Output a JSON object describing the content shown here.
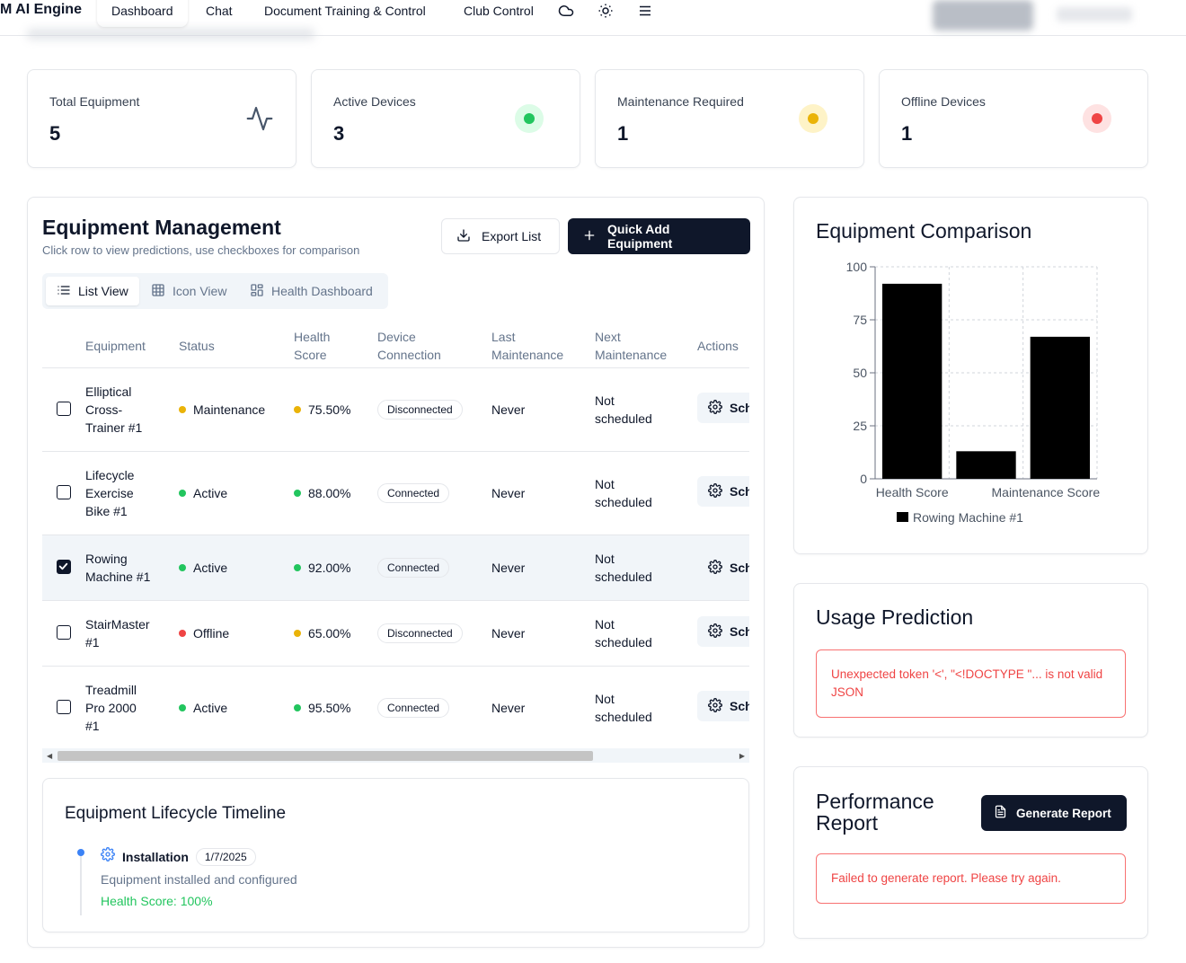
{
  "nav": {
    "brand": "M AI Engine",
    "tabs": [
      "Dashboard",
      "Chat",
      "Document Training & Control",
      "Club Control"
    ],
    "active_tab": "Dashboard"
  },
  "stats": [
    {
      "label": "Total Equipment",
      "value": "5",
      "icon": "activity-icon"
    },
    {
      "label": "Active Devices",
      "value": "3",
      "color": "#22c55e"
    },
    {
      "label": "Maintenance Required",
      "value": "1",
      "color": "#eab308"
    },
    {
      "label": "Offline Devices",
      "value": "1",
      "color": "#ef4444"
    }
  ],
  "equipment": {
    "title": "Equipment Management",
    "subtitle": "Click row to view predictions, use checkboxes for comparison",
    "export_label": "Export List",
    "quick_add_label": "Quick Add Equipment",
    "views": [
      "List View",
      "Icon View",
      "Health Dashboard"
    ],
    "active_view": "List View",
    "columns": {
      "equipment": "Equipment",
      "status": "Status",
      "health": [
        "Health",
        "Score"
      ],
      "device": [
        "Device",
        "Connection"
      ],
      "last": [
        "Last",
        "Maintenance"
      ],
      "next": [
        "Next",
        "Maintenance"
      ],
      "actions": "Actions"
    },
    "action_label": "Sch",
    "rows": [
      {
        "name": [
          "Elliptical",
          "Cross-",
          "Trainer #1"
        ],
        "status": "Maintenance",
        "status_color": "#eab308",
        "health": "75.50%",
        "health_color": "#eab308",
        "connection": "Disconnected",
        "last": "Never",
        "next": [
          "Not",
          "scheduled"
        ],
        "checked": false
      },
      {
        "name": [
          "Lifecycle",
          "Exercise",
          "Bike #1"
        ],
        "status": "Active",
        "status_color": "#22c55e",
        "health": "88.00%",
        "health_color": "#22c55e",
        "connection": "Connected",
        "last": "Never",
        "next": [
          "Not",
          "scheduled"
        ],
        "checked": false
      },
      {
        "name": [
          "Rowing",
          "Machine #1"
        ],
        "status": "Active",
        "status_color": "#22c55e",
        "health": "92.00%",
        "health_color": "#22c55e",
        "connection": "Connected",
        "last": "Never",
        "next": [
          "Not",
          "scheduled"
        ],
        "checked": true
      },
      {
        "name": [
          "StairMaster",
          "#1"
        ],
        "status": "Offline",
        "status_color": "#ef4444",
        "health": "65.00%",
        "health_color": "#eab308",
        "connection": "Disconnected",
        "last": "Never",
        "next": [
          "Not",
          "scheduled"
        ],
        "checked": false
      },
      {
        "name": [
          "Treadmill",
          "Pro 2000",
          "#1"
        ],
        "status": "Active",
        "status_color": "#22c55e",
        "health": "95.50%",
        "health_color": "#22c55e",
        "connection": "Connected",
        "last": "Never",
        "next": [
          "Not",
          "scheduled"
        ],
        "checked": false
      }
    ]
  },
  "timeline": {
    "title": "Equipment Lifecycle Timeline",
    "event": "Installation",
    "date": "1/7/2025",
    "description": "Equipment installed and configured",
    "health": "Health Score: 100%"
  },
  "comparison": {
    "title": "Equipment Comparison"
  },
  "chart_data": {
    "type": "bar",
    "categories": [
      "Health Score",
      "",
      "Maintenance Score"
    ],
    "series": [
      {
        "name": "Rowing Machine #1",
        "values": [
          92,
          13,
          67
        ],
        "color": "#000000"
      }
    ],
    "ylim": [
      0,
      100
    ],
    "yticks": [
      0,
      25,
      50,
      75,
      100
    ],
    "grid": true,
    "legend": "bottom"
  },
  "usage": {
    "title": "Usage Prediction",
    "error": "Unexpected token '<', \"<!DOCTYPE \"... is not valid JSON"
  },
  "performance": {
    "title_lines": [
      "Performance",
      "Report"
    ],
    "button": "Generate Report",
    "error": "Failed to generate report. Please try again."
  }
}
